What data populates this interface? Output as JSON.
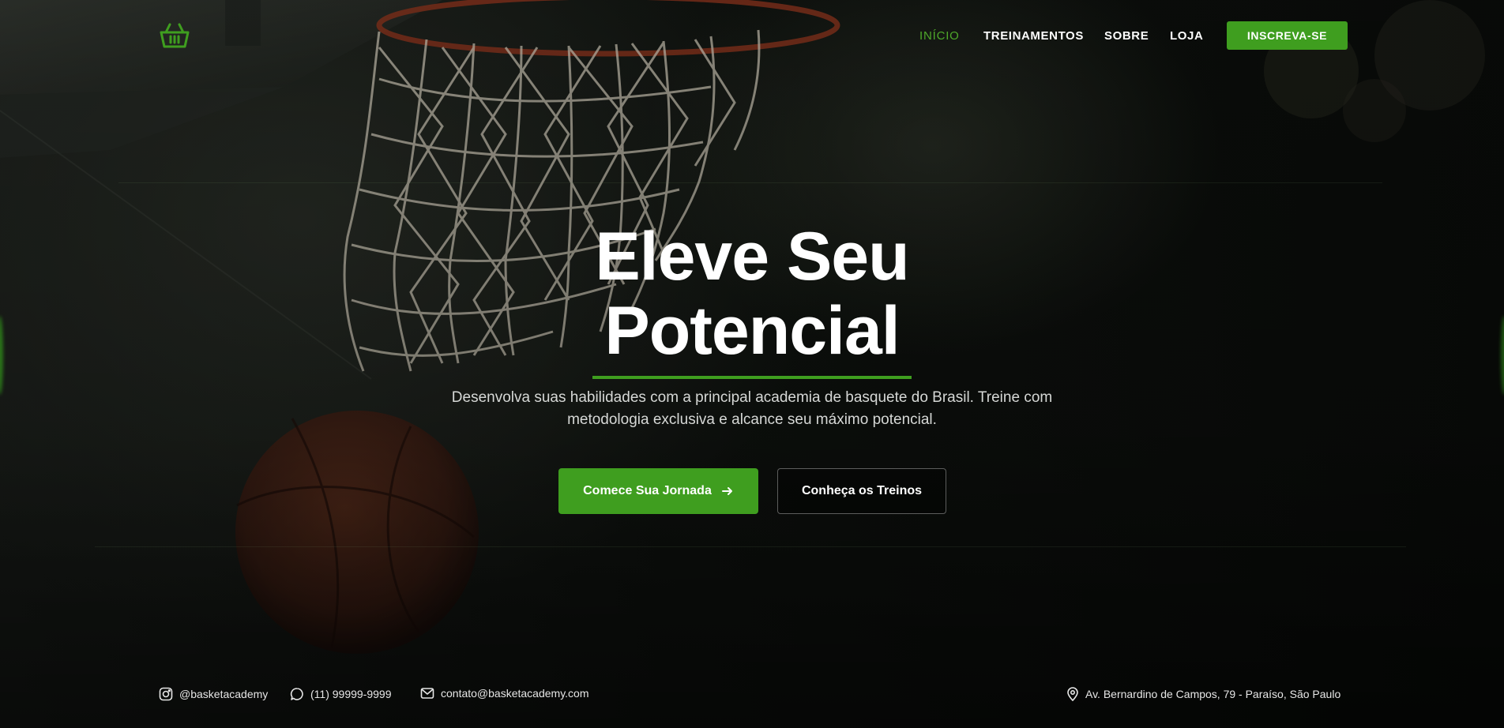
{
  "nav": {
    "items": [
      {
        "label": "INÍCIO",
        "active": true
      },
      {
        "label": "TREINAMENTOS",
        "active": false
      },
      {
        "label": "SOBRE",
        "active": false
      },
      {
        "label": "LOJA",
        "active": false
      }
    ],
    "cta_label": "INSCREVA-SE",
    "logo_icon": "basket-icon"
  },
  "hero": {
    "title_line1": "Eleve Seu",
    "title_line2": "Potencial",
    "subtitle": "Desenvolva suas habilidades com a principal academia de basquete do Brasil. Treine com metodologia exclusiva e alcance seu máximo potencial.",
    "primary_button": "Comece Sua Jornada",
    "secondary_button": "Conheça os Treinos"
  },
  "footer": {
    "instagram": "@basketacademy",
    "phone": "(11) 99999-9999",
    "email": "contato@basketacademy.com",
    "address": "Av. Bernardino de Campos, 79 - Paraíso, São Paulo"
  },
  "colors": {
    "accent": "#3f9e1f",
    "accent_text": "#4ea82a",
    "background": "#0b0d0b"
  }
}
